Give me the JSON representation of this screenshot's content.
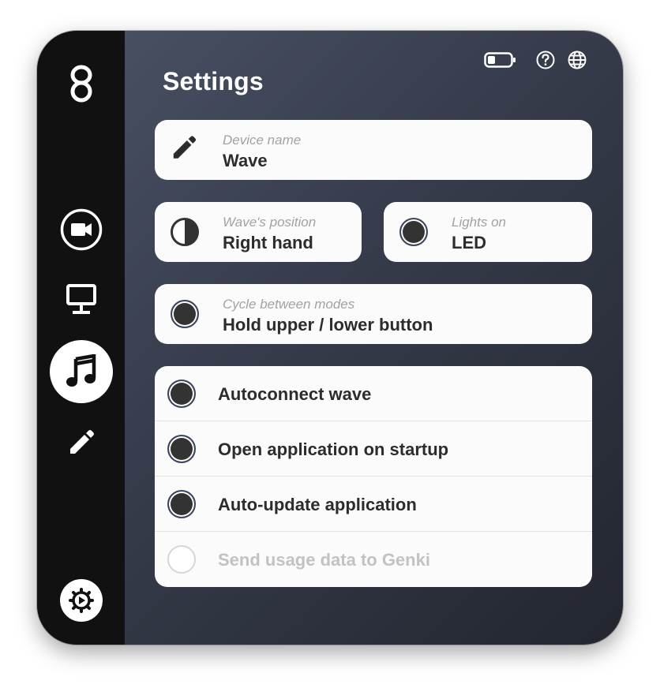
{
  "sidebar": {
    "logo_icon": "genki-logo-icon",
    "items": [
      {
        "name": "video",
        "icon": "video-camera-icon"
      },
      {
        "name": "display",
        "icon": "monitor-icon"
      },
      {
        "name": "music",
        "icon": "music-note-icon",
        "active": true
      },
      {
        "name": "edit",
        "icon": "pencil-icon"
      }
    ],
    "settings_icon": "settings-gear-icon"
  },
  "header": {
    "title": "Settings",
    "icons": [
      "battery-icon",
      "help-icon",
      "globe-icon"
    ]
  },
  "device": {
    "label": "Device name",
    "value": "Wave",
    "icon": "pencil-icon"
  },
  "position": {
    "label": "Wave's position",
    "value": "Right hand",
    "icon": "half-circle-icon"
  },
  "lights": {
    "label": "Lights on",
    "value": "LED",
    "icon": "filled-circle-icon"
  },
  "cycle": {
    "label": "Cycle between modes",
    "value": "Hold upper / lower button",
    "icon": "filled-circle-icon"
  },
  "options": [
    {
      "label": "Autoconnect wave",
      "enabled": true
    },
    {
      "label": "Open application on startup",
      "enabled": true
    },
    {
      "label": "Auto-update application",
      "enabled": true
    },
    {
      "label": "Send usage data to Genki",
      "enabled": false
    }
  ],
  "colors": {
    "panel_top": "#4b5366",
    "panel_bottom": "#23262f",
    "sidebar": "#111111",
    "card": "#fbfbfb",
    "text_dark": "#2c2c2c",
    "text_muted": "#a2a2a2"
  }
}
